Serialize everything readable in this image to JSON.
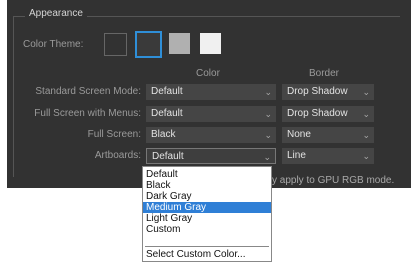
{
  "appearance": {
    "legend": "Appearance",
    "color_theme_label": "Color Theme:",
    "themes": [
      "dark",
      "medium-dark (selected)",
      "medium-light",
      "light"
    ]
  },
  "columns": {
    "color": "Color",
    "border": "Border"
  },
  "rows": [
    {
      "label": "Standard Screen Mode:",
      "color": "Default",
      "border": "Drop Shadow"
    },
    {
      "label": "Full Screen with Menus:",
      "color": "Default",
      "border": "Drop Shadow"
    },
    {
      "label": "Full Screen:",
      "color": "Black",
      "border": "None"
    },
    {
      "label": "Artboards:",
      "color": "Default",
      "border": "Line"
    }
  ],
  "note": "y apply to GPU RGB mode.",
  "dropdown": {
    "options": [
      "Default",
      "Black",
      "Dark Gray",
      "Medium Gray",
      "Light Gray",
      "Custom"
    ],
    "highlighted": "Medium Gray",
    "custom_action": "Select Custom Color..."
  },
  "colors": {
    "panel_bg": "#323232",
    "accent": "#2f8fd8",
    "highlight": "#2f7fd6"
  },
  "icons": {
    "chevron": "chevron-down-icon"
  }
}
